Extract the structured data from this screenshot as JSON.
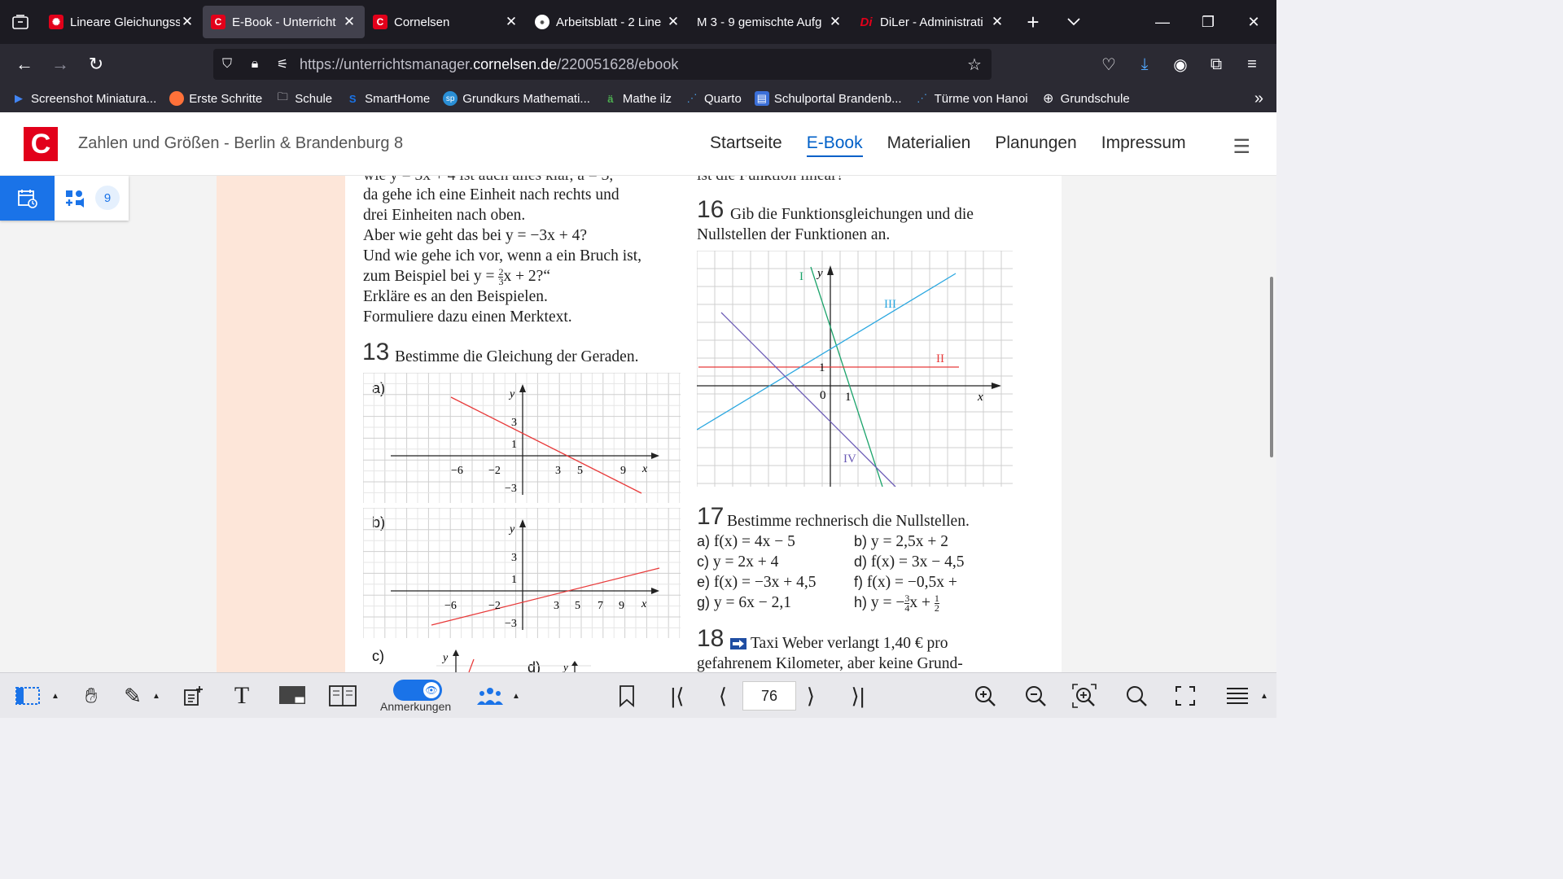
{
  "browser": {
    "tabs": [
      {
        "title": "Lineare Gleichungss",
        "favicon_color": "#e2001a",
        "active": false
      },
      {
        "title": "E-Book - Unterricht",
        "favicon_color": "#e2001a",
        "favicon_text": "C",
        "active": true
      },
      {
        "title": "Cornelsen",
        "favicon_color": "#e2001a",
        "favicon_text": "C",
        "active": false
      },
      {
        "title": "Arbeitsblatt - 2 Line",
        "favicon_color": "#ffffff",
        "active": false
      },
      {
        "title": "M 3 - 9 gemischte Aufg",
        "favicon_color": "#1c1b22",
        "active": false
      },
      {
        "title": "DiLer - Administrati",
        "favicon_color": "#e2001a",
        "favicon_text": "Di",
        "active": false
      }
    ],
    "url_prefix": "https://unterrichtsmanager.",
    "url_domain": "cornelsen.de",
    "url_path": "/220051628/ebook",
    "bookmarks": [
      "Screenshot  Miniatura...",
      "Erste Schritte",
      "Schule",
      "SmartHome",
      "Grundkurs Mathemati...",
      "Mathe ilz",
      "Quarto",
      "Schulportal Brandenb...",
      "Türme von Hanoi",
      "Grundschule"
    ]
  },
  "app": {
    "logo": "C",
    "book_title": "Zahlen und Größen - Berlin & Brandenburg 8",
    "nav": [
      "Startseite",
      "E-Book",
      "Materialien",
      "Planungen",
      "Impressum"
    ],
    "active_nav": "E-Book",
    "media_count": "9"
  },
  "page": {
    "left_text": [
      "da gehe ich eine Einheit nach rechts und",
      "drei Einheiten nach oben.",
      "Aber wie geht das bei y = −3x + 4?",
      "Und wie gehe ich vor, wenn a ein Bruch ist,",
      "Erkläre es an den Beispielen.",
      "Formuliere dazu einen Merktext."
    ],
    "left_frac_line": {
      "before": "zum Beispiel bei y = ",
      "num": "2",
      "den": "3",
      "after": "x + 2?“"
    },
    "ex13": {
      "num": "13",
      "text": "Bestimme die Gleichung der Geraden.",
      "labels": [
        "a)",
        "b)",
        "c)",
        "d)"
      ]
    },
    "ex16": {
      "num": "16",
      "text1": "Gib die Funktionsgleichungen und die",
      "text2": "Nullstellen der Funktionen an."
    },
    "ex17": {
      "num": "17",
      "text": "Bestimme rechnerisch die Nullstellen.",
      "items": [
        {
          "label": "a)",
          "expr": "f(x) = 4x − 5"
        },
        {
          "label": "b)",
          "expr": "y = 2,5x + 2"
        },
        {
          "label": "c)",
          "expr": "y = 2x + 4"
        },
        {
          "label": "d)",
          "expr": "f(x) = 3x − 4,5"
        },
        {
          "label": "e)",
          "expr": "f(x) = −3x + 4,5"
        },
        {
          "label": "f)",
          "expr": "f(x) = −0,5x +"
        },
        {
          "label": "g)",
          "expr": "y = 6x − 2,1"
        },
        {
          "label": "h)",
          "expr_before": "y = −",
          "num1": "3",
          "den1": "4",
          "mid": "x + ",
          "num2": "1",
          "den2": "2"
        }
      ]
    },
    "ex18": {
      "num": "18",
      "text1": "Taxi Weber verlangt 1,40 € pro",
      "text2": "gefahrenem Kilometer, aber keine Grund-"
    }
  },
  "graph13a": {
    "ticks_x": [
      "−6",
      "−2",
      "3",
      "5",
      "9",
      "x"
    ],
    "ticks_y": [
      "y",
      "3",
      "1",
      "−3"
    ],
    "line_color": "#e83a3a"
  },
  "graph13b": {
    "ticks_x": [
      "−6",
      "−2",
      "3",
      "5",
      "7",
      "9",
      "x"
    ],
    "ticks_y": [
      "y",
      "3",
      "1",
      "−3"
    ],
    "line_color": "#e83a3a"
  },
  "graph16": {
    "axis_labels": {
      "x": "x",
      "y": "y",
      "origin": "0",
      "one_x": "1",
      "one_y": "1"
    },
    "lines": [
      {
        "name": "I",
        "color": "#1aa36a"
      },
      {
        "name": "II",
        "color": "#e83a3a"
      },
      {
        "name": "III",
        "color": "#2aa7e0"
      },
      {
        "name": "IV",
        "color": "#6a5ab5"
      }
    ]
  },
  "toolbar": {
    "annotations_label": "Anmerkungen",
    "current_page": "76"
  }
}
